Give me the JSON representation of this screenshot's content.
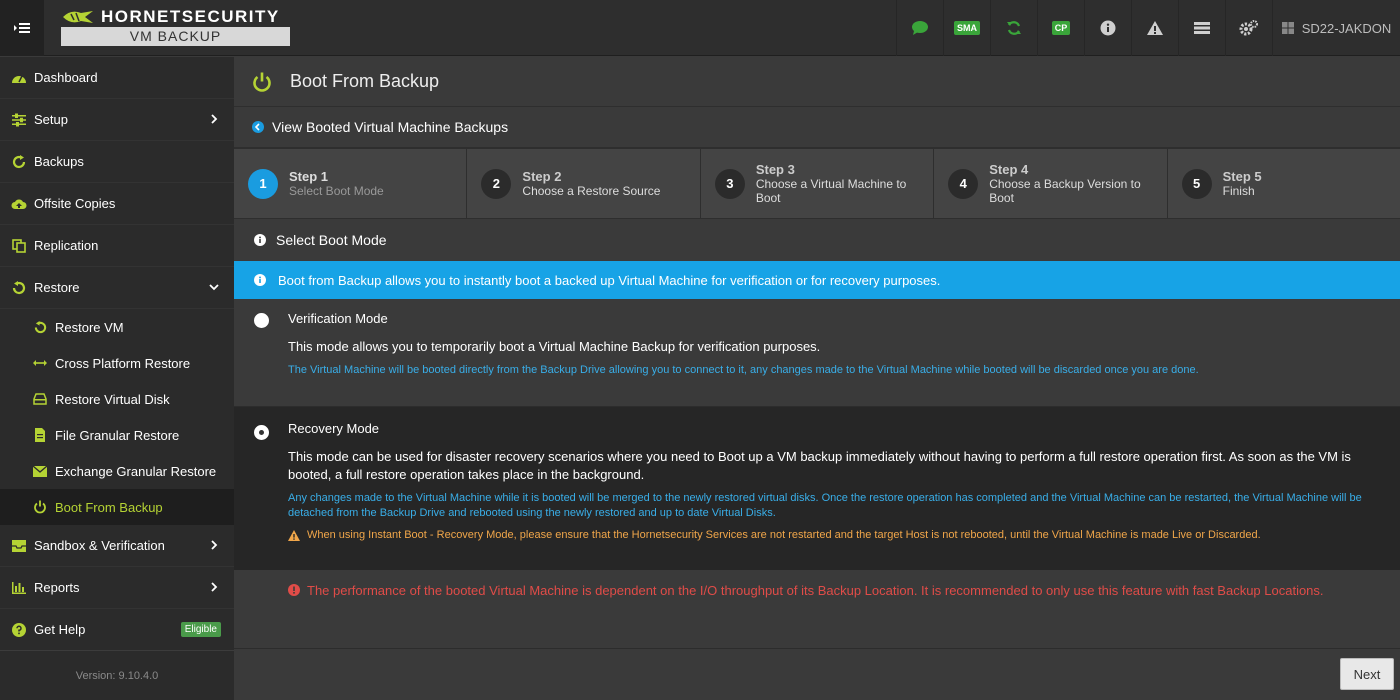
{
  "brand": {
    "name": "HORNETSECURITY",
    "product": "VM BACKUP"
  },
  "topbar": {
    "sma_label": "SMA",
    "cp_label": "CP",
    "host_label": "SD22-JAKDON"
  },
  "sidebar": {
    "items": [
      {
        "label": "Dashboard"
      },
      {
        "label": "Setup"
      },
      {
        "label": "Backups"
      },
      {
        "label": "Offsite Copies"
      },
      {
        "label": "Replication"
      },
      {
        "label": "Restore"
      }
    ],
    "restore_sub": [
      {
        "label": "Restore VM"
      },
      {
        "label": "Cross Platform Restore"
      },
      {
        "label": "Restore Virtual Disk"
      },
      {
        "label": "File Granular Restore"
      },
      {
        "label": "Exchange Granular Restore"
      },
      {
        "label": "Boot From Backup"
      }
    ],
    "after": [
      {
        "label": "Sandbox & Verification"
      },
      {
        "label": "Reports"
      },
      {
        "label": "Get Help",
        "badge": "Eligible"
      }
    ],
    "version": "Version: 9.10.4.0"
  },
  "page": {
    "title": "Boot From Backup",
    "back_link": "View Booted Virtual Machine Backups",
    "steps": [
      {
        "num": "1",
        "title": "Step 1",
        "sub": "Select Boot Mode"
      },
      {
        "num": "2",
        "title": "Step 2",
        "sub": "Choose a Restore Source"
      },
      {
        "num": "3",
        "title": "Step 3",
        "sub": "Choose a Virtual Machine to Boot"
      },
      {
        "num": "4",
        "title": "Step 4",
        "sub": "Choose a Backup Version to Boot"
      },
      {
        "num": "5",
        "title": "Step 5",
        "sub": "Finish"
      }
    ],
    "section_title": "Select Boot Mode",
    "info": "Boot from Backup allows you to instantly boot a backed up Virtual Machine for verification or for recovery purposes.",
    "verification": {
      "label": "Verification Mode",
      "desc": "This mode allows you to temporarily boot a Virtual Machine Backup for verification purposes.",
      "note": "The Virtual Machine will be booted directly from the Backup Drive allowing you to connect to it, any changes made to the Virtual Machine while booted will be discarded once you are done."
    },
    "recovery": {
      "label": "Recovery Mode",
      "desc": "This mode can be used for disaster recovery scenarios where you need to Boot up a VM backup immediately without having to perform a full restore operation first. As soon as the VM is booted, a full restore operation takes place in the background.",
      "note": "Any changes made to the Virtual Machine while it is booted will be merged to the newly restored virtual disks. Once the restore operation has completed and the Virtual Machine can be restarted, the Virtual Machine will be detached from the Backup Drive and rebooted using the newly restored and up to date Virtual Disks.",
      "warning": "When using Instant Boot - Recovery Mode, please ensure that the Hornetsecurity Services are not restarted and the target Host is not rebooted, until the Virtual Machine is made Live or Discarded."
    },
    "performance": "The performance of the booted Virtual Machine is dependent on the I/O throughput of its Backup Location. It is recommended to only use this feature with fast Backup Locations.",
    "next_label": "Next"
  },
  "colors": {
    "accent": "#b5d334",
    "info": "#17a3e6",
    "note": "#39aee8",
    "warning": "#f0a64a",
    "error": "#e04c48"
  }
}
